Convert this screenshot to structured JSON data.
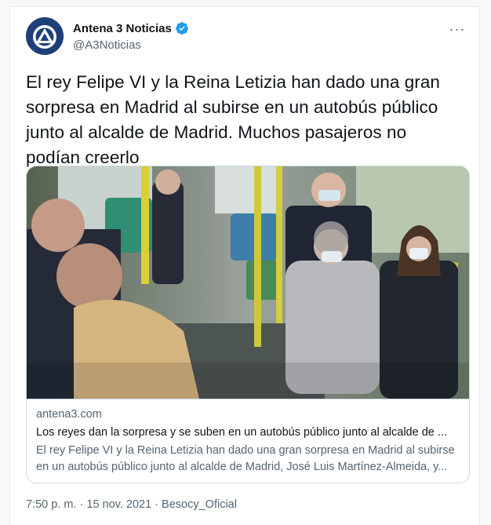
{
  "account": {
    "display_name": "Antena 3 Noticias",
    "handle": "@A3Noticias",
    "avatar_icon": "antena3-logo-icon",
    "verified_icon": "verified-badge-icon",
    "brand_color": "#1d3f7a",
    "verified_color": "#1d9bf0"
  },
  "tweet": {
    "more_icon": "more-options-icon",
    "more_label": "···",
    "text": "El rey Felipe VI y la Reina Letizia han dado una gran sorpresa en Madrid al subirse en un autobús público junto al alcalde de Madrid. Muchos pasajeros no podían creerlo"
  },
  "link_card": {
    "image_icon": "news-photo-image",
    "domain": "antena3.com",
    "title": "Los reyes dan la sorpresa y se suben en un autobús público junto al alcalde de ...",
    "description": "El rey Felipe VI y la Reina Letizia han dado una gran sorpresa en Madrid al subirse en un autobús público junto al alcalde de Madrid, José Luis Martínez-Almeida, y..."
  },
  "meta": {
    "time": "7:50 p. m.",
    "separator": " · ",
    "date": "15 nov. 2021",
    "source": "Besocy_Oficial"
  }
}
